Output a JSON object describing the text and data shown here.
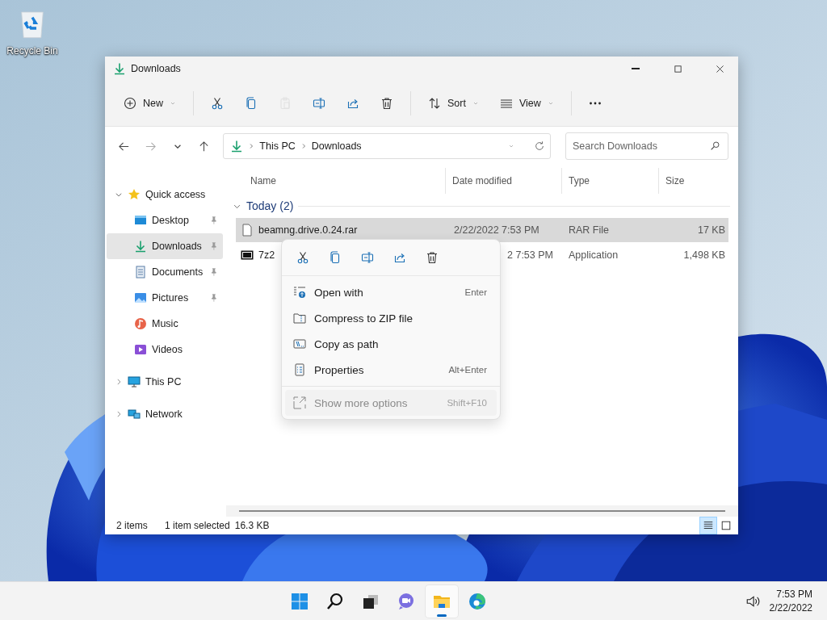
{
  "desktop_icons": [
    {
      "label": "Recycle Bin"
    }
  ],
  "window": {
    "title": "Downloads"
  },
  "toolbar": [
    {
      "kind": "new",
      "label": "New",
      "disabled": false
    },
    {
      "kind": "cut",
      "disabled": false
    },
    {
      "kind": "copy",
      "disabled": false
    },
    {
      "kind": "paste",
      "disabled": true
    },
    {
      "kind": "rename",
      "disabled": false
    },
    {
      "kind": "share",
      "disabled": false
    },
    {
      "kind": "delete",
      "disabled": false
    },
    {
      "kind": "sort",
      "label": "Sort",
      "disabled": false
    },
    {
      "kind": "view",
      "label": "View",
      "disabled": false
    },
    {
      "kind": "more",
      "disabled": false
    }
  ],
  "address": {
    "crumbs": [
      "This PC",
      "Downloads"
    ]
  },
  "search": {
    "placeholder": "Search Downloads"
  },
  "sidebar": {
    "items": [
      {
        "label": "Quick access",
        "expanded": true,
        "children": [
          {
            "label": "Desktop",
            "pinned": true,
            "selected": false
          },
          {
            "label": "Downloads",
            "pinned": true,
            "selected": true
          },
          {
            "label": "Documents",
            "pinned": true,
            "selected": false
          },
          {
            "label": "Pictures",
            "pinned": true,
            "selected": false
          },
          {
            "label": "Music",
            "pinned": false,
            "selected": false
          },
          {
            "label": "Videos",
            "pinned": false,
            "selected": false
          }
        ]
      },
      {
        "label": "This PC",
        "expanded": false
      },
      {
        "label": "Network",
        "expanded": false
      }
    ]
  },
  "table": {
    "columns": [
      "Name",
      "Date modified",
      "Type",
      "Size"
    ],
    "group": {
      "label": "Today (2)",
      "expanded": true
    },
    "rows": [
      {
        "name": "beamng.drive.0.24.rar",
        "date": "2/22/2022 7:53 PM",
        "type": "RAR File",
        "size": "17 KB",
        "selected": true,
        "date_covered": false
      },
      {
        "name": "7z2",
        "date": "2 7:53 PM",
        "type": "Application",
        "size": "1,498 KB",
        "selected": false,
        "date_covered": true
      }
    ]
  },
  "status_bar": {
    "item_count": "2 items",
    "selection": "1 item selected",
    "size": "16.3 KB",
    "views": [
      {
        "kind": "details",
        "selected": true
      },
      {
        "kind": "tiles",
        "selected": false
      }
    ]
  },
  "context_menu": {
    "quick_actions": [
      {
        "kind": "cut"
      },
      {
        "kind": "copy"
      },
      {
        "kind": "rename"
      },
      {
        "kind": "share"
      },
      {
        "kind": "delete"
      }
    ],
    "items": [
      {
        "label": "Open with",
        "shortcut": "Enter",
        "disabled": false
      },
      {
        "label": "Compress to ZIP file",
        "disabled": false
      },
      {
        "label": "Copy as path",
        "disabled": false
      },
      {
        "label": "Properties",
        "shortcut": "Alt+Enter",
        "disabled": false
      },
      {
        "label": "Show more options",
        "shortcut": "Shift+F10",
        "disabled": true
      }
    ]
  },
  "taskbar": {
    "apps": [
      {
        "kind": "start",
        "selected": false
      },
      {
        "kind": "search",
        "selected": false
      },
      {
        "kind": "task-view",
        "selected": false
      },
      {
        "kind": "chat",
        "selected": false
      },
      {
        "kind": "explorer",
        "selected": true
      },
      {
        "kind": "edge",
        "selected": false
      }
    ],
    "time": "7:53 PM",
    "date": "2/22/2022"
  }
}
